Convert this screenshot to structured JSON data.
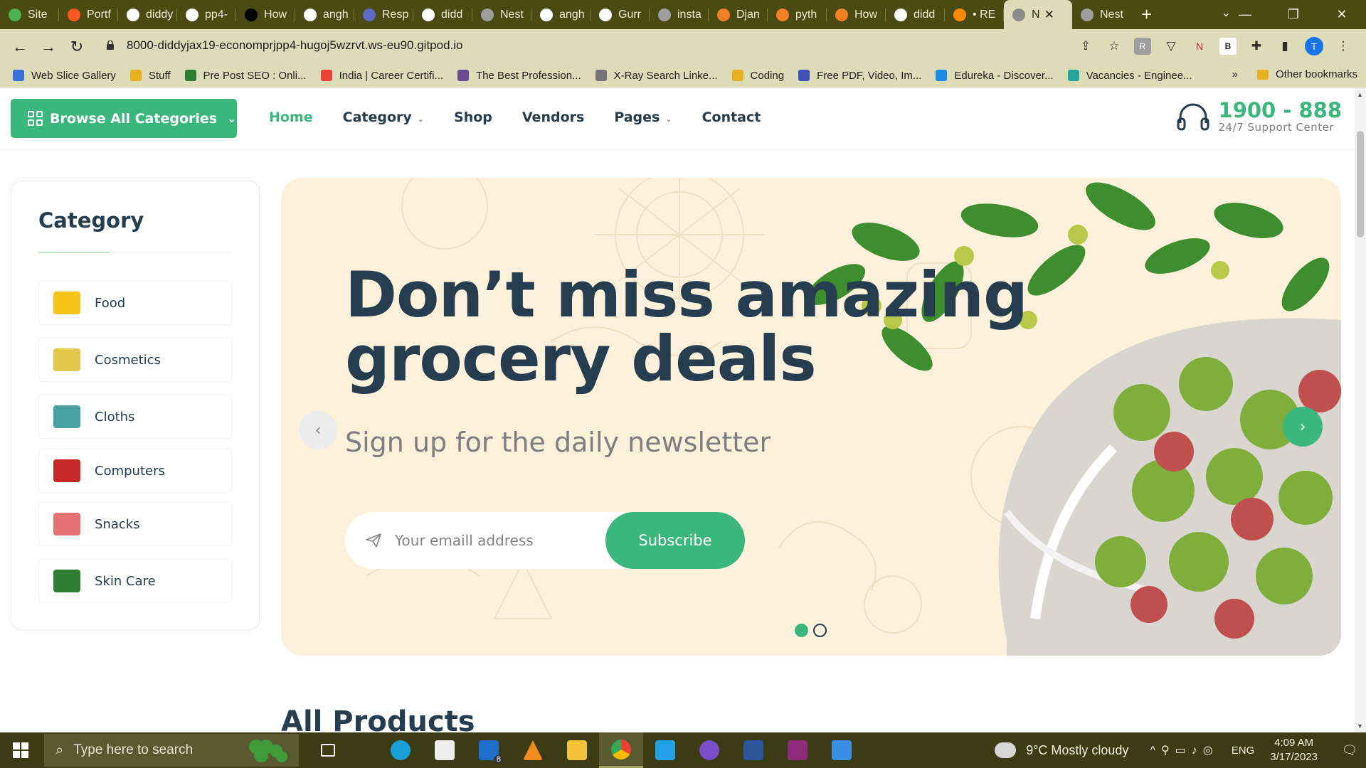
{
  "browser": {
    "tabs": [
      {
        "label": "Site",
        "color": "#4caf50"
      },
      {
        "label": "Portf",
        "color": "#ff5722"
      },
      {
        "label": "diddy",
        "color": "#ffffff"
      },
      {
        "label": "pp4-",
        "color": "#ffffff"
      },
      {
        "label": "How",
        "color": "#000000"
      },
      {
        "label": "angh",
        "color": "#ffffff"
      },
      {
        "label": "Resp",
        "color": "#5c6bc0"
      },
      {
        "label": "didd",
        "color": "#ffffff"
      },
      {
        "label": "Nest",
        "color": "#9e9e9e"
      },
      {
        "label": "angh",
        "color": "#ffffff"
      },
      {
        "label": "Gurr",
        "color": "#ffffff"
      },
      {
        "label": "insta",
        "color": "#9e9e9e"
      },
      {
        "label": "Djan",
        "color": "#f48024"
      },
      {
        "label": "pyth",
        "color": "#f48024"
      },
      {
        "label": "How",
        "color": "#f48024"
      },
      {
        "label": "didd",
        "color": "#ffffff"
      },
      {
        "label": "• RE",
        "color": "#ff8a00"
      }
    ],
    "active_tab": {
      "label": "N"
    },
    "last_tab": {
      "label": "Nest"
    },
    "url": "8000-diddyjax19-economprjpp4-hugoj5wzrvt.ws-eu90.gitpod.io",
    "profile_initial": "T",
    "bookmarks": [
      {
        "label": "Web Slice Gallery",
        "color": "#3a6fd8"
      },
      {
        "label": "Stuff",
        "color": "#e8b020"
      },
      {
        "label": "Pre Post SEO : Onli...",
        "color": "#2e7d32"
      },
      {
        "label": "India | Career Certifi...",
        "color": "#ea4335"
      },
      {
        "label": "The Best Profession...",
        "color": "#6a4c93"
      },
      {
        "label": "X-Ray Search Linke...",
        "color": "#757575"
      },
      {
        "label": "Coding",
        "color": "#e8b020"
      },
      {
        "label": "Free PDF, Video, Im...",
        "color": "#3f51b5"
      },
      {
        "label": "Edureka - Discover...",
        "color": "#1e88e5"
      },
      {
        "label": "Vacancies - Enginee...",
        "color": "#26a69a"
      }
    ],
    "bookmarks_more": "»",
    "other_bookmarks": "Other bookmarks"
  },
  "header": {
    "browse_label": "Browse  All Categories",
    "nav": [
      {
        "label": "Home",
        "active": true,
        "dropdown": false
      },
      {
        "label": "Category",
        "active": false,
        "dropdown": true
      },
      {
        "label": "Shop",
        "active": false,
        "dropdown": false
      },
      {
        "label": "Vendors",
        "active": false,
        "dropdown": false
      },
      {
        "label": "Pages",
        "active": false,
        "dropdown": true
      },
      {
        "label": "Contact",
        "active": false,
        "dropdown": false
      }
    ],
    "support_number": "1900 - 888",
    "support_sub": "24/7 Support Center"
  },
  "sidebar": {
    "title": "Category",
    "items": [
      {
        "label": "Food",
        "icon": "food-icon",
        "color": "#f5c518"
      },
      {
        "label": "Cosmetics",
        "icon": "cosmetics-icon",
        "color": "#e2c84a"
      },
      {
        "label": "Cloths",
        "icon": "cloths-icon",
        "color": "#4aa0a0"
      },
      {
        "label": "Computers",
        "icon": "computers-icon",
        "color": "#c62828"
      },
      {
        "label": "Snacks",
        "icon": "snacks-icon",
        "color": "#e57373"
      },
      {
        "label": "Skin Care",
        "icon": "skin-care-icon",
        "color": "#2e7d32"
      }
    ]
  },
  "hero": {
    "title_line1": "Don’t miss amazing",
    "title_line2": "grocery deals",
    "subtitle": "Sign up for the daily newsletter",
    "email_placeholder": "Your emaill address",
    "subscribe_label": "Subscribe",
    "slide_index": 1,
    "slide_count": 2
  },
  "section_title": "All Products",
  "taskbar": {
    "search_placeholder": "Type here to search",
    "mail_badge": "8",
    "weather": "9°C  Mostly cloudy",
    "lang": "ENG",
    "time": "4:09 AM",
    "date": "3/17/2023"
  },
  "colors": {
    "brand_green": "#3bb77e",
    "heading": "#253d4e",
    "hero_bg": "#fdf1db",
    "chrome": "#dcdcb8",
    "tabbar": "#4b4a12"
  }
}
